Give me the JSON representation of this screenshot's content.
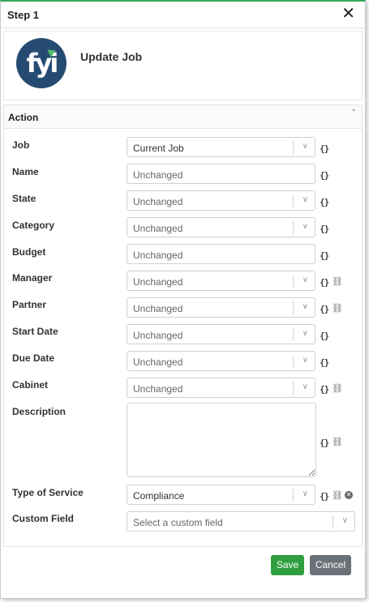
{
  "dialog": {
    "title": "Step 1",
    "close_glyph": "✕"
  },
  "header": {
    "title": "Update Job",
    "logo_text": "fyi"
  },
  "section": {
    "title": "Action",
    "caret": "ˇ"
  },
  "fields": [
    {
      "label": "Job",
      "value": "Current Job",
      "type": "select"
    },
    {
      "label": "Name",
      "value": "Unchanged",
      "type": "text"
    },
    {
      "label": "State",
      "value": "Unchanged",
      "type": "select"
    },
    {
      "label": "Category",
      "value": "Unchanged",
      "type": "select"
    },
    {
      "label": "Budget",
      "value": "Unchanged",
      "type": "text"
    },
    {
      "label": "Manager",
      "value": "Unchanged",
      "type": "select"
    },
    {
      "label": "Partner",
      "value": "Unchanged",
      "type": "select"
    },
    {
      "label": "Start Date",
      "value": "Unchanged",
      "type": "select"
    },
    {
      "label": "Due Date",
      "value": "Unchanged",
      "type": "select"
    },
    {
      "label": "Cabinet",
      "value": "Unchanged",
      "type": "select"
    },
    {
      "label": "Description",
      "value": "",
      "type": "textarea"
    },
    {
      "label": "Type of Service",
      "value": "Compliance",
      "type": "select"
    },
    {
      "label": "Custom Field",
      "value": "",
      "placeholder": "Select a custom field",
      "type": "select"
    }
  ],
  "icons": {
    "braces": "{}",
    "unlink": "⛓",
    "chevron": "∨",
    "clear": "✕"
  },
  "actions": {
    "save_label": "Save",
    "cancel_label": "Cancel"
  },
  "colors": {
    "save": "#2e9e3f",
    "cancel": "#6b7178",
    "logo_bg": "#264b73",
    "accent": "#3aa55a"
  }
}
